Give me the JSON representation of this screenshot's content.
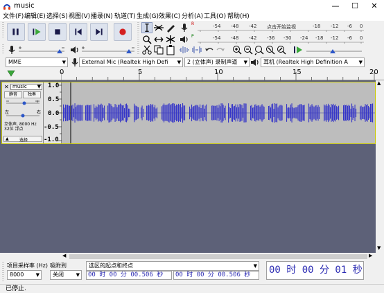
{
  "window": {
    "title": "music",
    "minimize": "—",
    "maximize": "☐",
    "close": "✕"
  },
  "menu": [
    "文件(F)",
    "编辑(E)",
    "选择(S)",
    "视图(V)",
    "播录(N)",
    "轨道(T)",
    "生成(G)",
    "效果(C)",
    "分析(A)",
    "工具(O)",
    "帮助(H)"
  ],
  "meters": {
    "record_scale": [
      "-54",
      "-48",
      "-42",
      "点击开始监视",
      "-18",
      "-12",
      "-6",
      "0"
    ],
    "play_scale": [
      "-54",
      "-48",
      "-42",
      "-36",
      "-30",
      "-24",
      "-18",
      "-12",
      "-6",
      "0"
    ],
    "record_marker": "R",
    "play_marker": "P"
  },
  "devices": {
    "host": "MME",
    "input": "External Mic (Realtek High Defi",
    "channels": "2 (立体声) 录制声道",
    "output": "耳机 (Realtek High Definition A"
  },
  "ruler": {
    "labels": [
      "0",
      "5",
      "10",
      "15",
      "20"
    ]
  },
  "track": {
    "name": "music",
    "mute": "静音",
    "solo": "独奏",
    "left": "左",
    "right": "右",
    "info": "立体声, 8000 Hz\n32位 浮点",
    "select": "选择",
    "scale": [
      "1.0",
      "0.5",
      "0.0",
      "-0.5",
      "-1.0"
    ]
  },
  "selection": {
    "rate_label": "项目采样率 (Hz)",
    "rate_value": "8000",
    "snap_label": "吸附到",
    "snap_value": "关闭",
    "mode_label": "选区的起点和终点",
    "start": "00 时 00 分 00.506 秒",
    "end": "00 时 00 分 00.506 秒",
    "time": "00 时 00 分 01 秒"
  },
  "status": "已停止."
}
